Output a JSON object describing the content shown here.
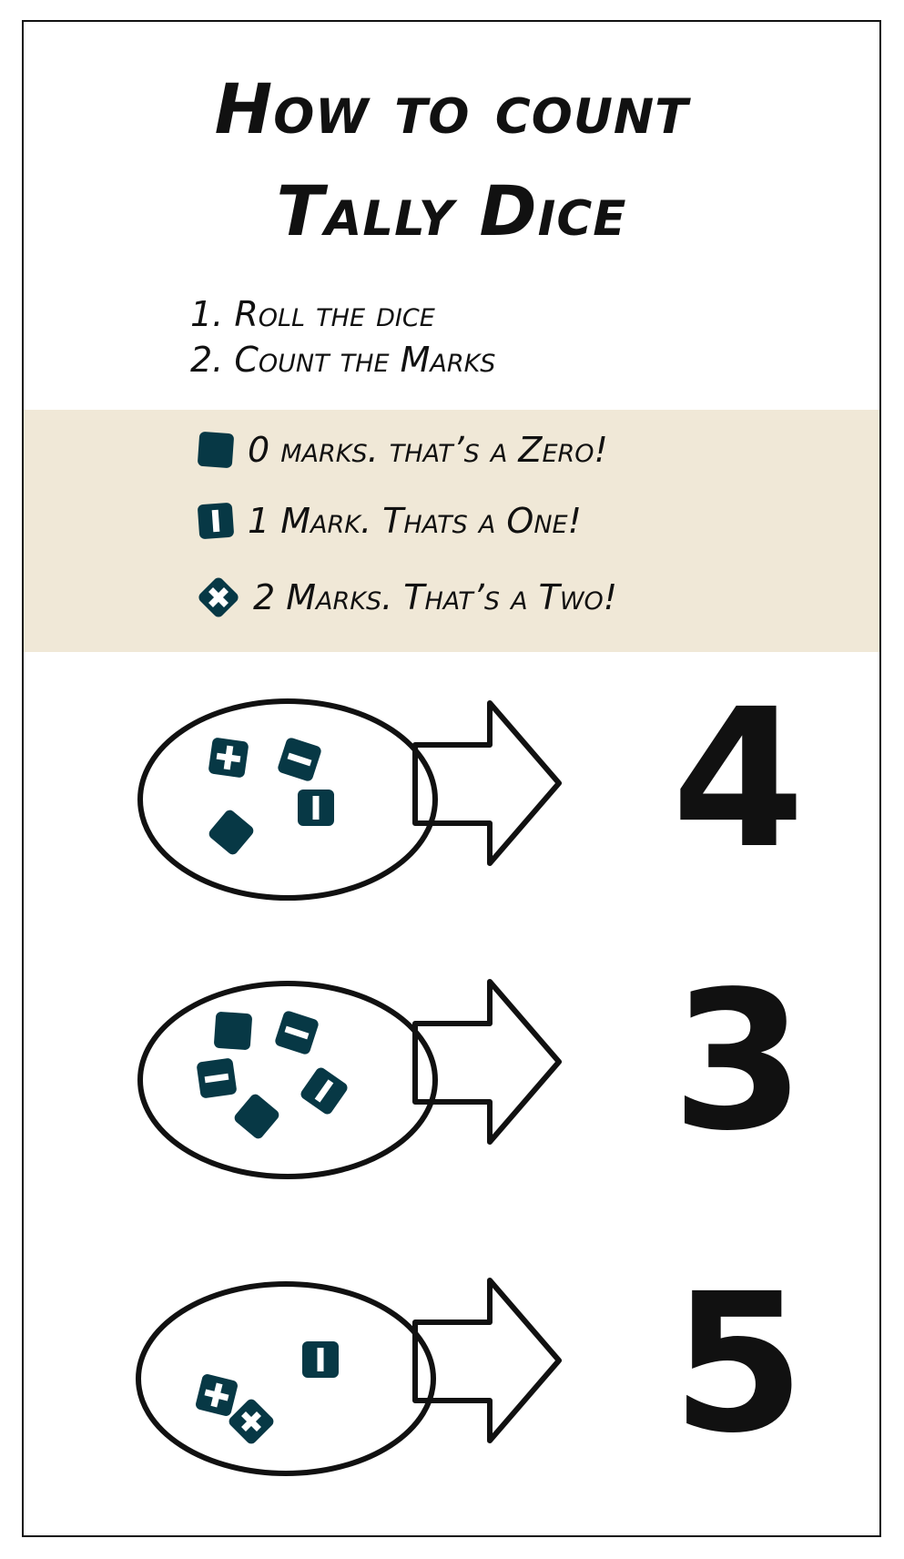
{
  "title": {
    "line1": "How to count",
    "line2": "Tally Dice"
  },
  "steps": [
    "1. Roll the dice",
    "2. Count the Marks"
  ],
  "legend": [
    {
      "marks": 0,
      "face": "blank-die-icon",
      "text": "0 marks. that’s a Zero!"
    },
    {
      "marks": 1,
      "face": "one-mark-die-icon",
      "text": "1 Mark. Thats a One!"
    },
    {
      "marks": 2,
      "face": "two-mark-die-icon",
      "text": "2 Marks. That’s a Two!"
    }
  ],
  "examples": [
    {
      "dice_marks": [
        2,
        1,
        1,
        0
      ],
      "total": "4"
    },
    {
      "dice_marks": [
        0,
        1,
        1,
        0,
        1
      ],
      "total": "3"
    },
    {
      "dice_marks": [
        2,
        2,
        1
      ],
      "total": "5"
    }
  ],
  "colors": {
    "die": "#073845",
    "legend_band": "#f0e8d7",
    "ink": "#111111"
  },
  "icons": {
    "arrow": "right-arrow-icon",
    "bag": "oval-icon"
  }
}
